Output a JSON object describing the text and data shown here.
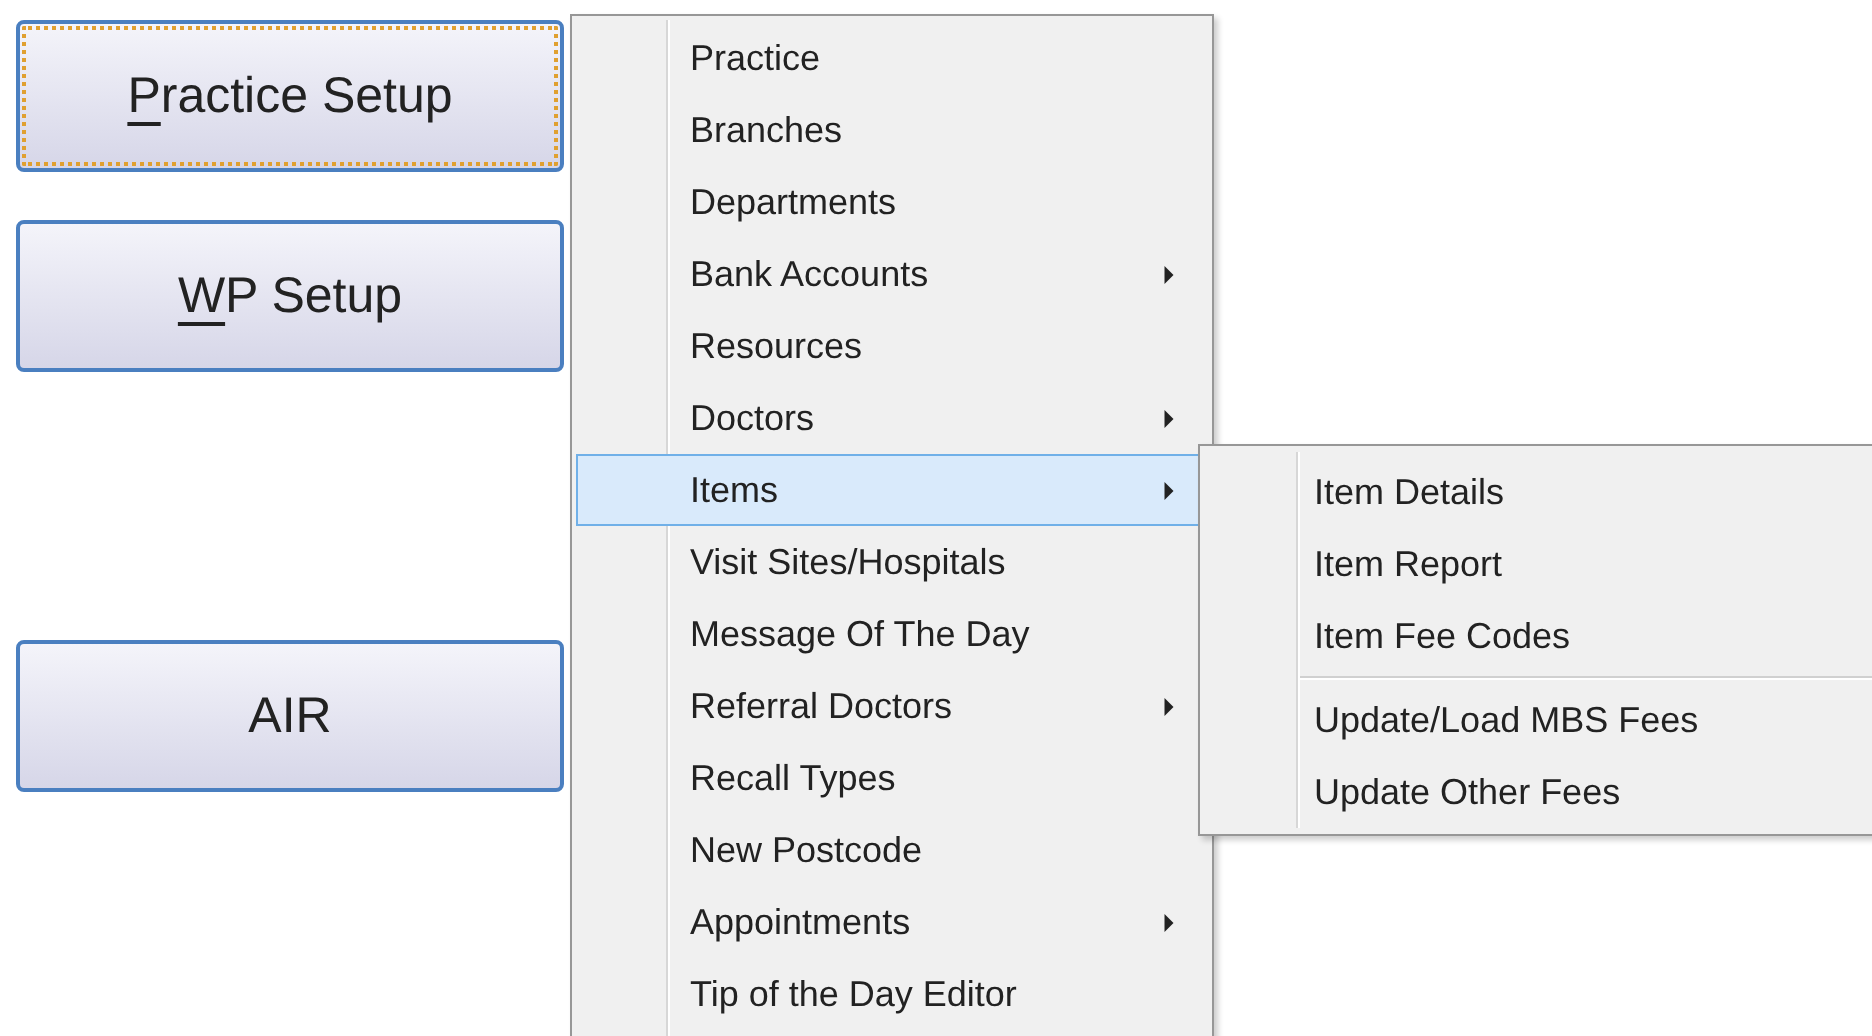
{
  "buttons": [
    {
      "label": "Practice Setup",
      "mnemonic_first": true,
      "focused": true
    },
    {
      "label": "WP Setup",
      "mnemonic_first": true,
      "focused": false
    },
    {
      "label": "AIR",
      "mnemonic_first": false,
      "focused": false
    }
  ],
  "menu": {
    "items": [
      {
        "label": "Practice",
        "submenu": false,
        "selected": false
      },
      {
        "label": "Branches",
        "submenu": false,
        "selected": false
      },
      {
        "label": "Departments",
        "submenu": false,
        "selected": false
      },
      {
        "label": "Bank Accounts",
        "submenu": true,
        "selected": false
      },
      {
        "label": "Resources",
        "submenu": false,
        "selected": false
      },
      {
        "label": "Doctors",
        "submenu": true,
        "selected": false
      },
      {
        "label": "Items",
        "submenu": true,
        "selected": true
      },
      {
        "label": "Visit Sites/Hospitals",
        "submenu": false,
        "selected": false
      },
      {
        "label": "Message Of The Day",
        "submenu": false,
        "selected": false
      },
      {
        "label": "Referral Doctors",
        "submenu": true,
        "selected": false
      },
      {
        "label": "Recall Types",
        "submenu": false,
        "selected": false
      },
      {
        "label": "New Postcode",
        "submenu": false,
        "selected": false
      },
      {
        "label": "Appointments",
        "submenu": true,
        "selected": false
      },
      {
        "label": "Tip of the Day Editor",
        "submenu": false,
        "selected": false
      }
    ]
  },
  "submenu": {
    "items": [
      {
        "kind": "item",
        "label": "Item Details"
      },
      {
        "kind": "item",
        "label": "Item Report"
      },
      {
        "kind": "item",
        "label": "Item Fee Codes"
      },
      {
        "kind": "separator"
      },
      {
        "kind": "item",
        "label": "Update/Load MBS Fees"
      },
      {
        "kind": "item",
        "label": "Update Other Fees"
      }
    ]
  }
}
